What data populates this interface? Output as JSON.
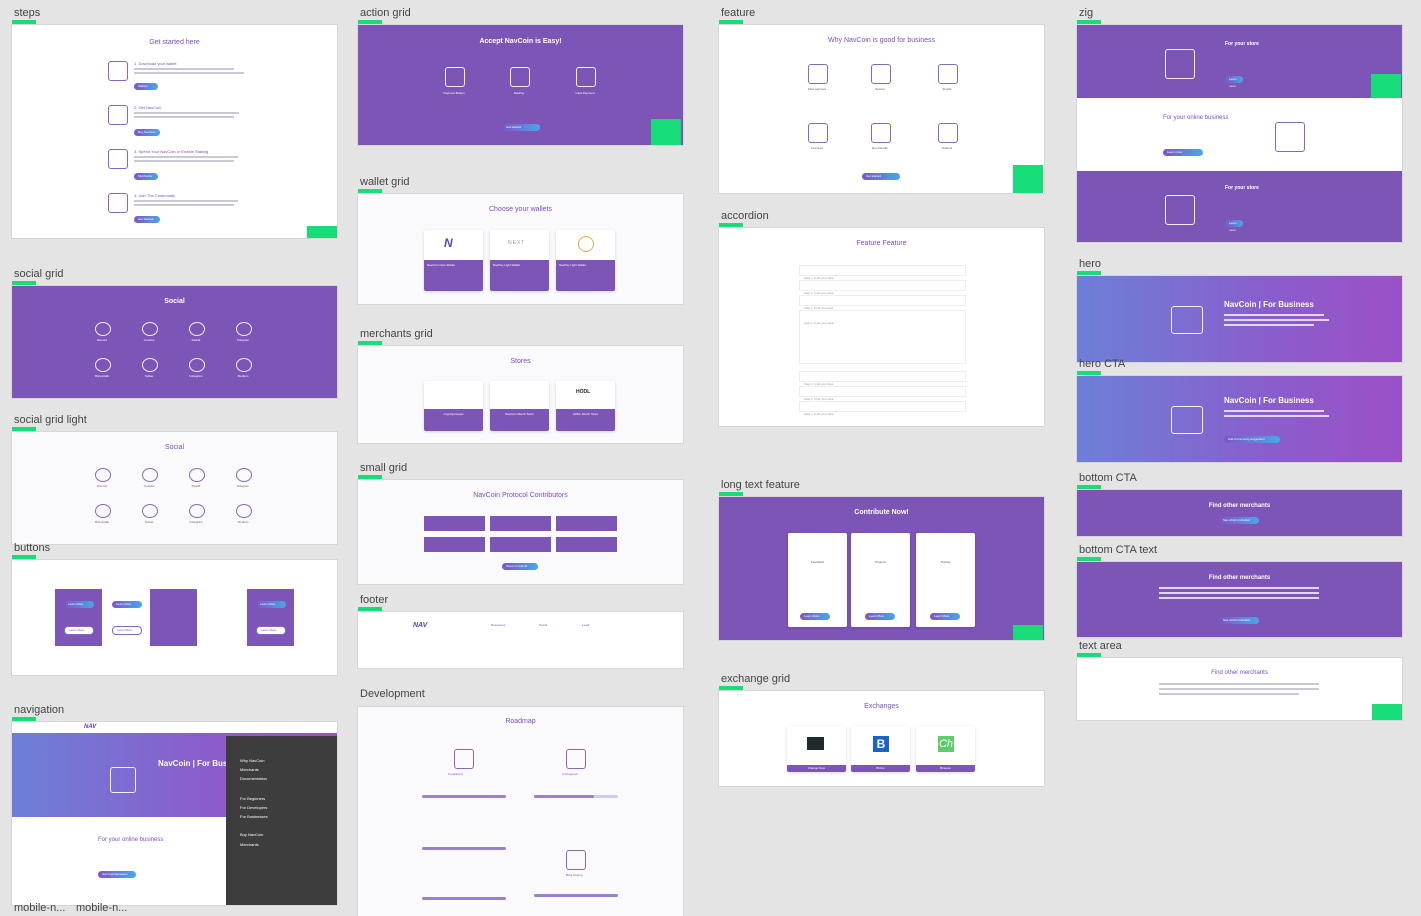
{
  "labels": {
    "steps": "steps",
    "action_grid": "action grid",
    "feature": "feature",
    "zig": "zig",
    "wallet_grid": "wallet grid",
    "accordion": "accordion",
    "social_grid": "social grid",
    "merchants_grid": "merchants grid",
    "hero": "hero",
    "hero_cta": "hero CTA",
    "social_grid_light": "social grid light",
    "small_grid": "small grid",
    "long_text_feature": "long text feature",
    "bottom_cta": "bottom CTA",
    "buttons": "buttons",
    "footer": "footer",
    "bottom_cta_text": "bottom CTA  text",
    "text_area": "text area",
    "exchange_grid": "exchange grid",
    "development": "Development",
    "navigation": "navigation",
    "mobile_1": "mobile-n...",
    "mobile_2": "mobile-n..."
  },
  "steps": {
    "title": "Get started here",
    "items": [
      {
        "title": "1. Download your wallet",
        "button": "Wallets"
      },
      {
        "title": "2. Get NavCoin",
        "button": "Buy NavCoin"
      },
      {
        "title": "3. Spend Your NavCoin or Enable Staking",
        "button": "Merchants"
      },
      {
        "title": "4. Join The Community",
        "button": "Get Started"
      }
    ]
  },
  "action_grid": {
    "title": "Accept NavCoin is Easy!",
    "items": [
      "Payment Button",
      "NavPay",
      "Card Payment"
    ],
    "button": "Get started"
  },
  "feature": {
    "title": "Why NavCoin is good for business",
    "items": [
      "Fast payment",
      "Secure",
      "Simple",
      "Low fees",
      "Eco friendly",
      "Options"
    ],
    "button": "Get started"
  },
  "zig": {
    "row1_title": "For your store",
    "row2_title": "For your online business",
    "row3_title": "For your store",
    "button": "Learn more"
  },
  "wallet_grid": {
    "title": "Choose your wallets",
    "cards": [
      {
        "name": "NavCoin Core Wallet"
      },
      {
        "name": "NavPay Light Wallet"
      },
      {
        "name": "NavPay Light Wallet"
      }
    ],
    "next_logo": "NEXT"
  },
  "accordion": {
    "title": "Feature Feature",
    "rows": [
      "Step 1. Find your idea",
      "Step 1. Find your idea",
      "Step 1. Find your idea",
      "Step 1. Find your idea",
      "Step 1. Find your idea",
      "Step 1. Find your idea",
      "Step 1. Find your idea"
    ]
  },
  "social": {
    "title": "Social",
    "items": [
      "Discord",
      "Youtube",
      "Reddit",
      "Telegram",
      "Bitcointalk",
      "Twitter",
      "Instagram",
      "Medium"
    ]
  },
  "merchants_grid": {
    "title": "Stores",
    "cards": [
      "Cryptopewpew",
      "NavCoin Merch Store",
      "HODL Merch Store"
    ],
    "hodl_logo": "HODL"
  },
  "hero": {
    "title": "NavCoin | For Business",
    "cta": "Add Community suggestion"
  },
  "small_grid": {
    "title": "NavCoin Protocol Contributors",
    "button": "Show on Github"
  },
  "long_text_feature": {
    "title": "Contribute Now!",
    "cards": [
      "Feedback",
      "Projects",
      "Testing"
    ],
    "button": "Learn More"
  },
  "bottom_cta": {
    "title": "Find other merchants",
    "button": "See what's Included"
  },
  "bottom_cta_text": {
    "title": "Find other merchants",
    "button": "See what's Included"
  },
  "text_area": {
    "title": "Find other merchants"
  },
  "buttons": {
    "learn_more": "Learn More"
  },
  "footer": {
    "logo": "NAV",
    "columns": [
      "Resources",
      "Social",
      "Legal"
    ]
  },
  "exchange_grid": {
    "title": "Exchanges",
    "cards": [
      "Change Now",
      "Bittrex",
      "Binance"
    ]
  },
  "development": {
    "title": "Roadmap",
    "stages": [
      "Completed",
      "In Progress",
      "Beta Testing"
    ]
  },
  "navigation": {
    "logo": "NAV",
    "menu_items": [
      "Why NavCoin",
      "Merchants",
      "Documentation",
      "For Beginners",
      "For Developers",
      "For Businesses",
      "Buy NavCoin",
      "Merchants"
    ],
    "hero_title": "NavCoin | For Bus",
    "section_title": "For your online business",
    "button": "Get Cryptopewpew"
  },
  "colors": {
    "purple": "#7d55b7",
    "accent_green": "#17dd78",
    "canvas": "#e4e4e4"
  }
}
